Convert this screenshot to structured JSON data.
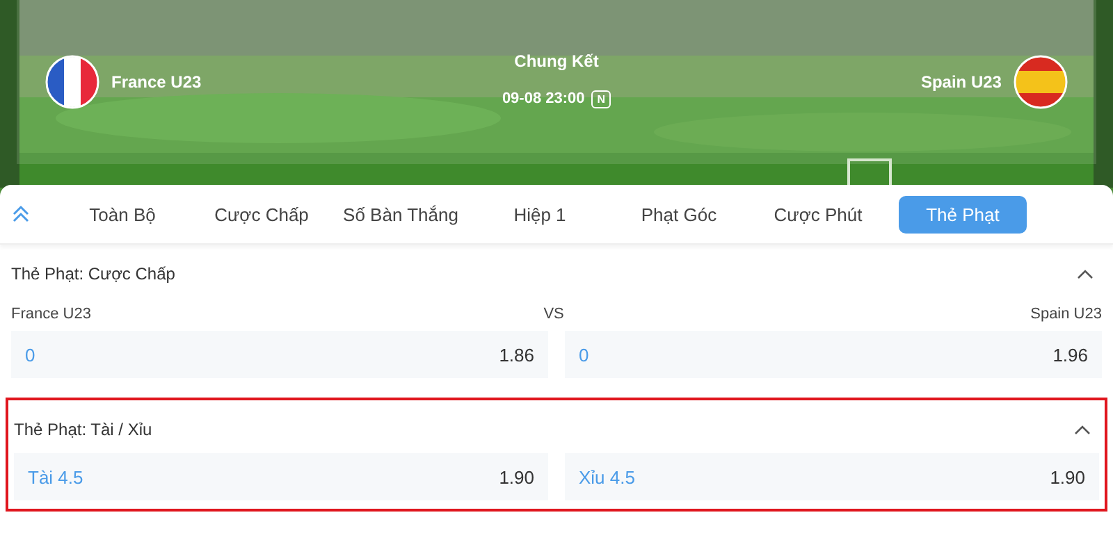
{
  "match": {
    "home": "France U23",
    "away": "Spain U23",
    "stage": "Chung Kết",
    "time": "09-08 23:00",
    "badge": "N"
  },
  "tabs": [
    {
      "label": "Toàn Bộ",
      "selected": false
    },
    {
      "label": "Cược Chấp",
      "selected": false
    },
    {
      "label": "Số Bàn Thắng",
      "selected": false
    },
    {
      "label": "Hiệp 1",
      "selected": false
    },
    {
      "label": "Phạt Góc",
      "selected": false
    },
    {
      "label": "Cược Phút",
      "selected": false
    },
    {
      "label": "Thẻ Phạt",
      "selected": true
    }
  ],
  "sections": [
    {
      "title": "Thẻ Phạt: Cược Chấp",
      "highlighted": false,
      "teams": {
        "home": "France U23",
        "vs": "VS",
        "away": "Spain U23"
      },
      "odds": [
        {
          "label": "0",
          "price": "1.86"
        },
        {
          "label": "0",
          "price": "1.96"
        }
      ]
    },
    {
      "title": "Thẻ Phạt: Tài / Xỉu",
      "highlighted": true,
      "odds": [
        {
          "label": "Tài 4.5",
          "price": "1.90"
        },
        {
          "label": "Xỉu 4.5",
          "price": "1.90"
        }
      ]
    }
  ]
}
